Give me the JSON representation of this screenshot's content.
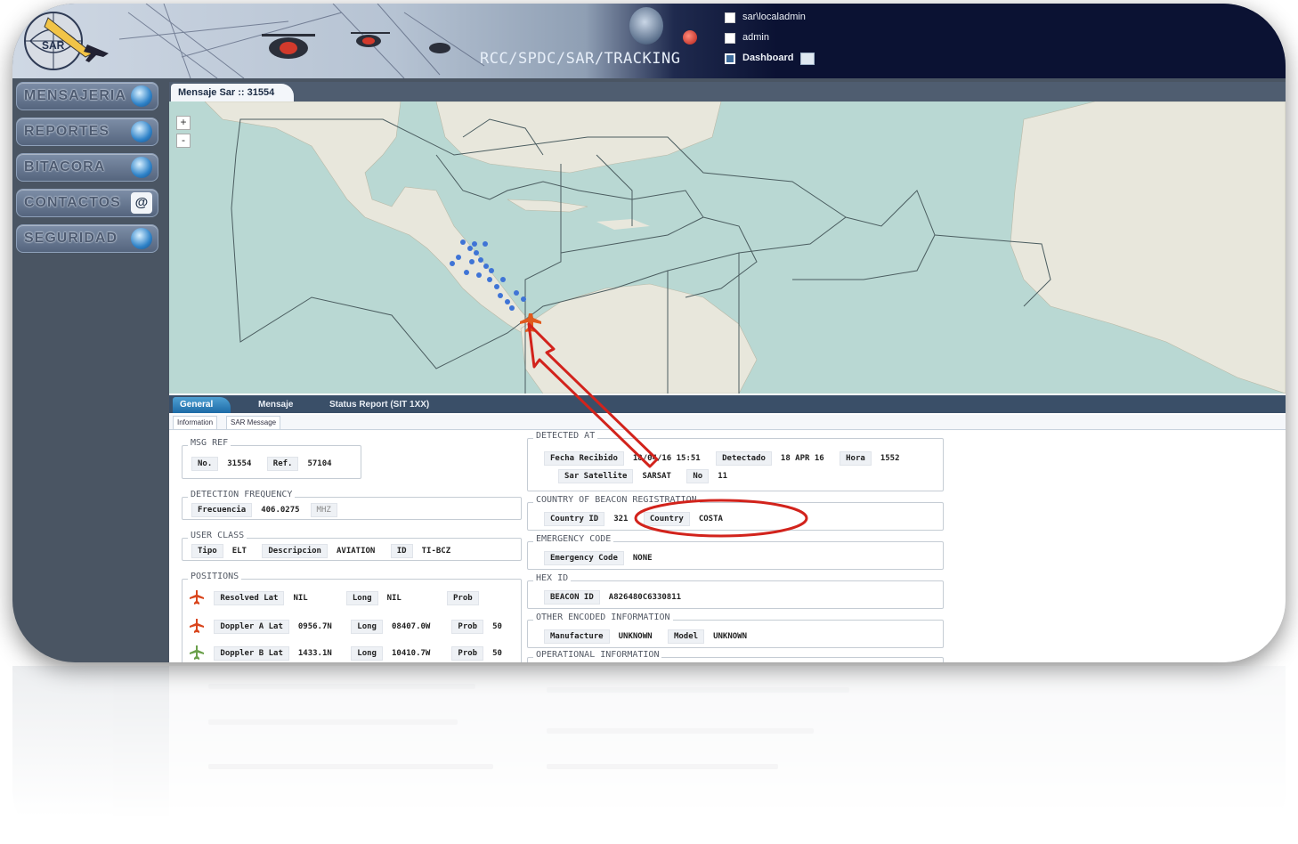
{
  "header": {
    "app_title": "RCC/SPDC/SAR/TRACKING",
    "logo_text": "SAR",
    "user_path": "sar\\localadmin",
    "user": "admin",
    "dashboard_label": "Dashboard"
  },
  "sidebar": {
    "items": [
      {
        "label": "MENSAJERIA",
        "icon": "message-globe-icon"
      },
      {
        "label": "REPORTES",
        "icon": "report-globe-icon"
      },
      {
        "label": "BITACORA",
        "icon": "log-book-icon"
      },
      {
        "label": "CONTACTOS",
        "icon": "at-sign-icon"
      },
      {
        "label": "SEGURIDAD",
        "icon": "security-icon"
      }
    ]
  },
  "main": {
    "tab_label": "Mensaje Sar :: 31554",
    "zoom_in": "+",
    "zoom_out": "-"
  },
  "details": {
    "tabs": [
      "General",
      "Mensaje",
      "Status Report (SIT 1XX)"
    ],
    "subtabs": [
      "Information",
      "SAR Message"
    ],
    "msg_ref": {
      "legend": "MSG REF",
      "no_label": "No.",
      "no": "31554",
      "ref_label": "Ref.",
      "ref": "57104"
    },
    "detection_frequency": {
      "legend": "DETECTION FREQUENCY",
      "label": "Frecuencia",
      "value": "406.0275",
      "unit": "MHZ"
    },
    "user_class": {
      "legend": "USER CLASS",
      "tipo_label": "Tipo",
      "tipo": "ELT",
      "desc_label": "Descripcion",
      "desc": "AVIATION",
      "id_label": "ID",
      "id": "TI-BCZ"
    },
    "positions": {
      "legend": "POSITIONS",
      "rows": [
        {
          "lat_label": "Resolved Lat",
          "lat": "NIL",
          "long_label": "Long",
          "long": "NIL",
          "prob_label": "Prob",
          "prob": ""
        },
        {
          "lat_label": "Doppler A Lat",
          "lat": "0956.7N",
          "long_label": "Long",
          "long": "08407.0W",
          "prob_label": "Prob",
          "prob": "50"
        },
        {
          "lat_label": "Doppler B Lat",
          "lat": "1433.1N",
          "long_label": "Long",
          "long": "10410.7W",
          "prob_label": "Prob",
          "prob": "50"
        }
      ]
    },
    "detected_at": {
      "legend": "DETECTED AT",
      "fecha_label": "Fecha Recibido",
      "fecha": "18/04/16 15:51",
      "detectado_label": "Detectado",
      "detectado": "18 APR 16",
      "hora_label": "Hora",
      "hora": "1552",
      "sat_label": "Sar Satellite",
      "sat": "SARSAT",
      "no_label": "No",
      "no": "11"
    },
    "country": {
      "legend": "COUNTRY OF BEACON REGISTRATION",
      "id_label": "Country ID",
      "id": "321",
      "country_label": "Country",
      "country": "COSTA"
    },
    "emergency": {
      "legend": "EMERGENCY CODE",
      "label": "Emergency Code",
      "value": "NONE"
    },
    "hex": {
      "legend": "HEX ID",
      "label": "BEACON ID",
      "value": "A826480C6330811"
    },
    "other": {
      "legend": "OTHER ENCODED INFORMATION",
      "manu_label": "Manufacture",
      "manu": "UNKNOWN",
      "model_label": "Model",
      "model": "UNKNOWN"
    },
    "operational": {
      "legend": "OPERATIONAL INFORMATION"
    }
  }
}
